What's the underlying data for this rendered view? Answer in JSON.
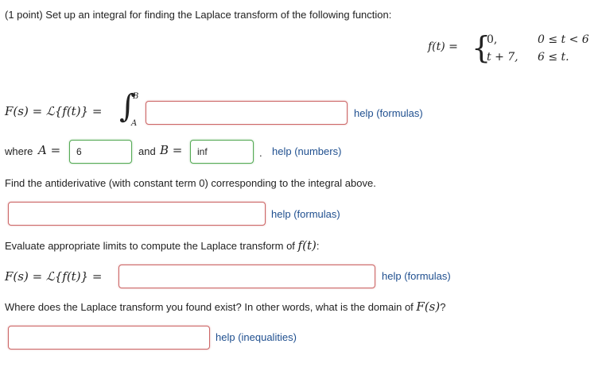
{
  "problem": {
    "header": "(1 point) Set up an integral for finding the Laplace transform of the following function:",
    "piecewise": {
      "lhs": "f(t) =",
      "case1_value": "0,",
      "case1_condition": "0 ≤ t < 6",
      "case2_value": "t + 7,",
      "case2_condition": "6 ≤ t."
    }
  },
  "part1": {
    "lhs": "F(s) = ℒ{f(t)} =",
    "integral_sign": "∫",
    "upper_limit": "B",
    "lower_limit": "A",
    "answer_value": "",
    "help_label": "help (formulas)"
  },
  "limits": {
    "where_label": "where",
    "a_label": "A =",
    "a_value": "6",
    "and_label": "and",
    "b_label": "B =",
    "b_value": "inf",
    "period": ".",
    "help_label": "help (numbers)"
  },
  "part2": {
    "prompt": "Find the antiderivative (with constant term 0) corresponding to the integral above.",
    "answer_value": "",
    "help_label": "help (formulas)"
  },
  "part3": {
    "prompt": "Evaluate appropriate limits to compute the Laplace transform of",
    "prompt_math": "f(t)",
    "prompt_end": ":",
    "lhs": "F(s) = ℒ{f(t)} =",
    "answer_value": "",
    "help_label": "help (formulas)"
  },
  "part4": {
    "prompt": "Where does the Laplace transform you found exist? In other words, what is the domain of",
    "prompt_math": "F(s)",
    "prompt_end": "?",
    "answer_value": "",
    "help_label": "help (inequalities)"
  },
  "colors": {
    "link": "#1f4f8f",
    "input_border_empty": "#cc6666",
    "input_border_filled": "#55aa55",
    "text": "#222222"
  }
}
